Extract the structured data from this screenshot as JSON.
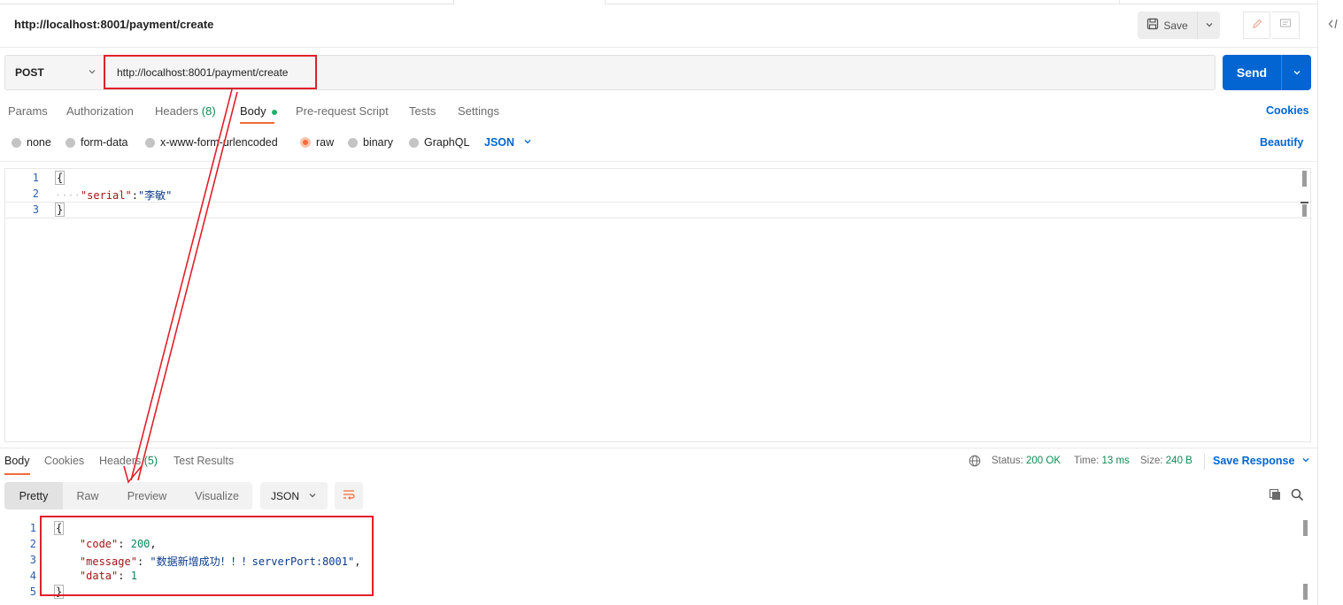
{
  "request": {
    "title": "http://localhost:8001/payment/create",
    "method": "POST",
    "url": "http://localhost:8001/payment/create",
    "save_label": "Save",
    "send_label": "Send"
  },
  "request_tabs": [
    {
      "label": "Params"
    },
    {
      "label": "Authorization"
    },
    {
      "label": "Headers",
      "count": "(8)"
    },
    {
      "label": "Body"
    },
    {
      "label": "Pre-request Script"
    },
    {
      "label": "Tests"
    },
    {
      "label": "Settings"
    }
  ],
  "cookies_label": "Cookies",
  "body_types": [
    "none",
    "form-data",
    "x-www-form-urlencoded",
    "raw",
    "binary",
    "GraphQL"
  ],
  "body_type_selected": "raw",
  "body_language": "JSON",
  "beautify_label": "Beautify",
  "request_body": {
    "line_numbers": [
      "1",
      "2",
      "3"
    ],
    "open_brace": "{",
    "indent_dots": "····",
    "key": "\"serial\"",
    "colon": ":",
    "value": "\"李敏\"",
    "close_brace": "}"
  },
  "response_tabs": [
    {
      "label": "Body"
    },
    {
      "label": "Cookies"
    },
    {
      "label": "Headers",
      "count": "(5)"
    },
    {
      "label": "Test Results"
    }
  ],
  "response_meta": {
    "status_label": "Status:",
    "status_value": "200 OK",
    "time_label": "Time:",
    "time_value": "13 ms",
    "size_label": "Size:",
    "size_value": "240 B",
    "save_response_label": "Save Response"
  },
  "view_modes": [
    "Pretty",
    "Raw",
    "Preview",
    "Visualize"
  ],
  "response_format": "JSON",
  "response_body": {
    "line_numbers": [
      "1",
      "2",
      "3",
      "4",
      "5"
    ],
    "open_brace": "{",
    "code_key": "\"code\"",
    "code_value": "200",
    "message_key": "\"message\"",
    "message_value": "\"数据新增成功！！！serverPort:8001\"",
    "data_key": "\"data\"",
    "data_value": "1",
    "close_brace": "}"
  },
  "colors": {
    "accent_blue": "#0265d2",
    "tab_underline": "#f26b3a",
    "status_green": "#0f8a52",
    "annotation_red": "#e0202a"
  }
}
